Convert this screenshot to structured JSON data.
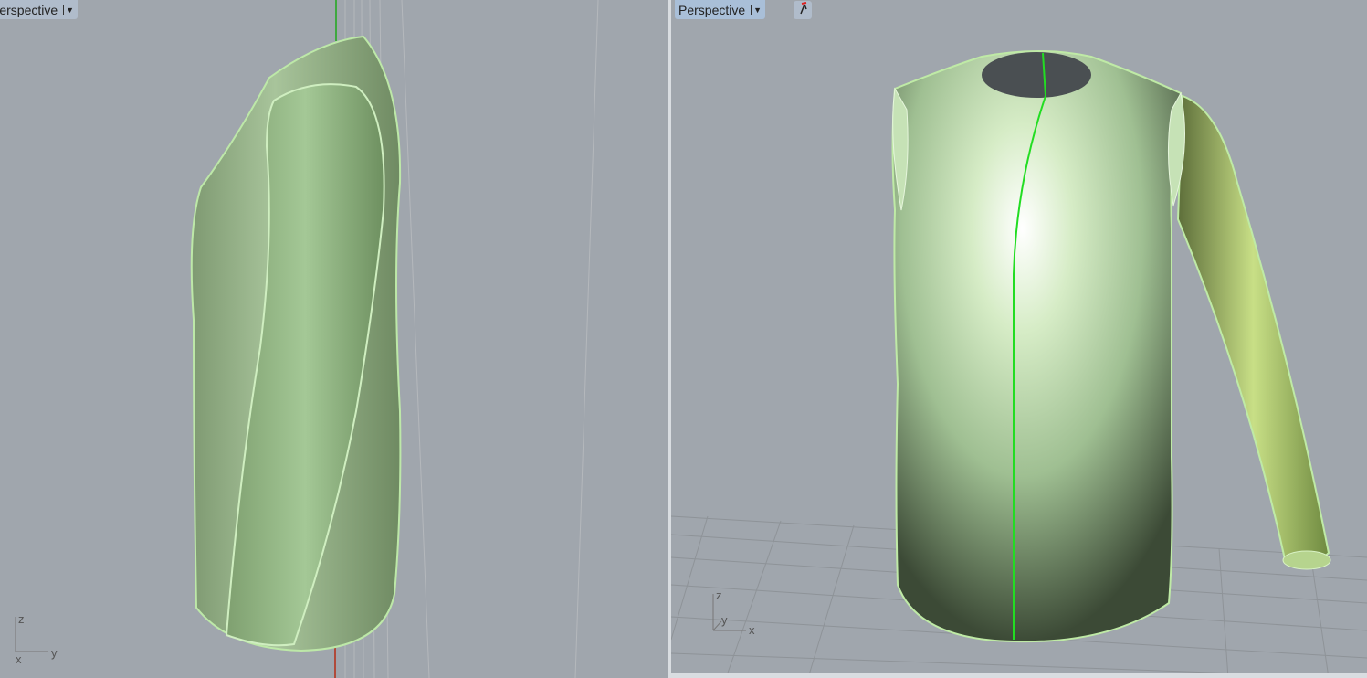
{
  "viewports": [
    {
      "label": "Perspective",
      "axes": {
        "z": "z",
        "x": "x",
        "y": "y"
      }
    },
    {
      "label": "Perspective",
      "axes": {
        "z": "z",
        "x": "x",
        "y": "y"
      }
    }
  ],
  "colors": {
    "background": "#a0a6ad",
    "garment": "#9fc092",
    "seam": "#22dd22"
  }
}
